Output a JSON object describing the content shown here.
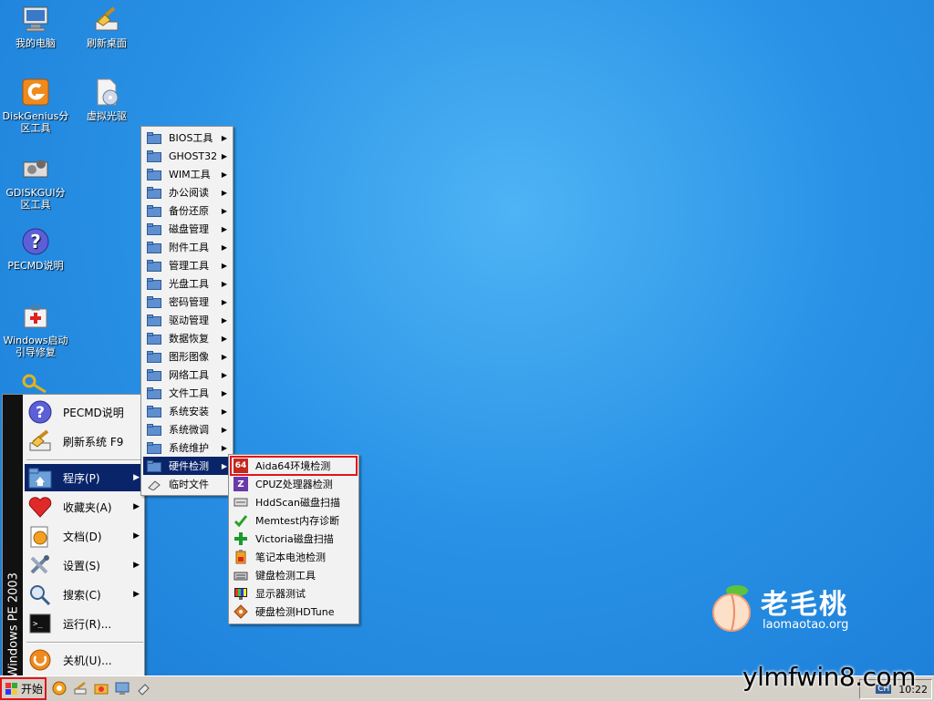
{
  "desktop": {
    "icons": [
      {
        "label": "我的电脑"
      },
      {
        "label": "刷新桌面"
      },
      {
        "label": "DiskGenius分区工具"
      },
      {
        "label": "虚拟光驱"
      },
      {
        "label": "GDISKGUI分区工具"
      },
      {
        "label": "PECMD说明"
      },
      {
        "label": "Windows启动引导修复"
      }
    ]
  },
  "start_menu": {
    "side_label": "Windows PE 2003",
    "items": [
      {
        "label": "PECMD说明",
        "icon": "help-icon"
      },
      {
        "label": "刷新系统 F9",
        "icon": "refresh-icon"
      },
      {
        "label": "程序(P)",
        "icon": "programs-icon",
        "submenu": true
      },
      {
        "label": "收藏夹(A)",
        "icon": "heart-icon",
        "submenu": true
      },
      {
        "label": "文档(D)",
        "icon": "document-icon",
        "submenu": true
      },
      {
        "label": "设置(S)",
        "icon": "settings-icon",
        "submenu": true
      },
      {
        "label": "搜索(C)",
        "icon": "search-icon",
        "submenu": true
      },
      {
        "label": "运行(R)...",
        "icon": "run-icon"
      },
      {
        "label": "关机(U)...",
        "icon": "shutdown-icon"
      }
    ]
  },
  "programs_menu": {
    "items": [
      "BIOS工具",
      "GHOST32",
      "WIM工具",
      "办公阅读",
      "备份还原",
      "磁盘管理",
      "附件工具",
      "管理工具",
      "光盘工具",
      "密码管理",
      "驱动管理",
      "数据恢复",
      "图形图像",
      "网络工具",
      "文件工具",
      "系统安装",
      "系统微调",
      "系统维护",
      "硬件检测",
      "临时文件"
    ]
  },
  "hardware_menu": {
    "items": [
      {
        "label": "Aida64环境检测",
        "icon": "aida64-icon"
      },
      {
        "label": "CPUZ处理器检测",
        "icon": "cpuz-icon"
      },
      {
        "label": "HddScan磁盘扫描",
        "icon": "hddscan-icon"
      },
      {
        "label": "Memtest内存诊断",
        "icon": "memtest-icon"
      },
      {
        "label": "Victoria磁盘扫描",
        "icon": "victoria-icon"
      },
      {
        "label": "笔记本电池检测",
        "icon": "battery-icon"
      },
      {
        "label": "键盘检测工具",
        "icon": "keyboard-icon"
      },
      {
        "label": "显示器测试",
        "icon": "monitor-test-icon"
      },
      {
        "label": "硬盘检测HDTune",
        "icon": "hdtune-icon"
      }
    ]
  },
  "taskbar": {
    "start_label": "开始",
    "tray_lang": "CH",
    "clock": "10:22"
  },
  "brand": {
    "name": "老毛桃",
    "url": "laomaotao.org"
  },
  "watermark": "ylmfwin8.com",
  "colors": {
    "desktop": "#2a93e6",
    "menu_bg": "#f2f2f2",
    "selected": "#0a246a",
    "highlight_box": "#e0151b"
  }
}
